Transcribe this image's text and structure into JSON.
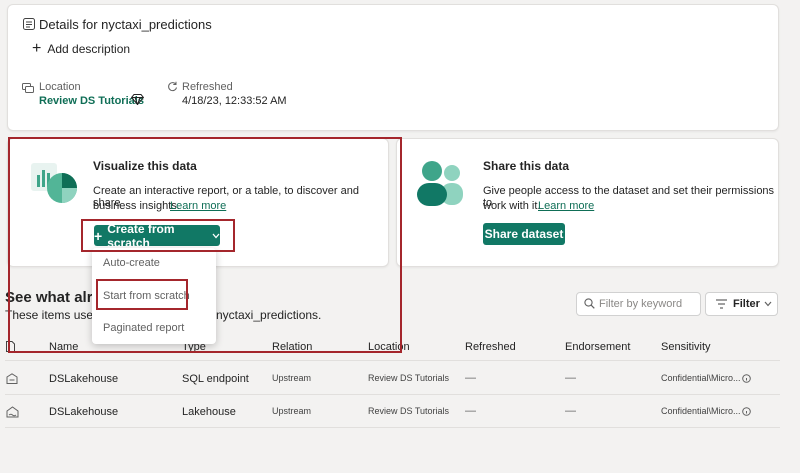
{
  "details": {
    "title": "Details for nyctaxi_predictions",
    "add_description": "Add description",
    "location_label": "Location",
    "location_value": "Review DS Tutorials",
    "refreshed_label": "Refreshed",
    "refreshed_value": "4/18/23, 12:33:52 AM"
  },
  "visualize": {
    "title": "Visualize this data",
    "desc": "Create an interactive report, or a table, to discover and share",
    "desc2": "business insights.",
    "learn_more": "Learn more",
    "button": "Create from scratch"
  },
  "share": {
    "title": "Share this data",
    "desc": "Give people access to the dataset and set their permissions to",
    "desc2": "work with it.",
    "learn_more": "Learn more",
    "button": "Share dataset"
  },
  "menu": {
    "items": [
      "Auto-create",
      "Start from scratch",
      "Paginated report"
    ]
  },
  "related": {
    "heading_left": "See what alrea",
    "heading_right": "nyctaxi_predictions.",
    "subtext_left": "These items use th",
    "filter_placeholder": "Filter by keyword",
    "filter_button": "Filter"
  },
  "table": {
    "headers": [
      "Name",
      "Type",
      "Relation",
      "Location",
      "Refreshed",
      "Endorsement",
      "Sensitivity"
    ],
    "rows": [
      {
        "name": "DSLakehouse",
        "type": "SQL endpoint",
        "relation": "Upstream",
        "location": "Review DS Tutorials",
        "refreshed": "—",
        "endorsement": "—",
        "sensitivity": "Confidential\\Micro..."
      },
      {
        "name": "DSLakehouse",
        "type": "Lakehouse",
        "relation": "Upstream",
        "location": "Review DS Tutorials",
        "refreshed": "—",
        "endorsement": "—",
        "sensitivity": "Confidential\\Micro..."
      }
    ]
  },
  "colors": {
    "accent": "#117865",
    "highlight": "#a4262c"
  }
}
